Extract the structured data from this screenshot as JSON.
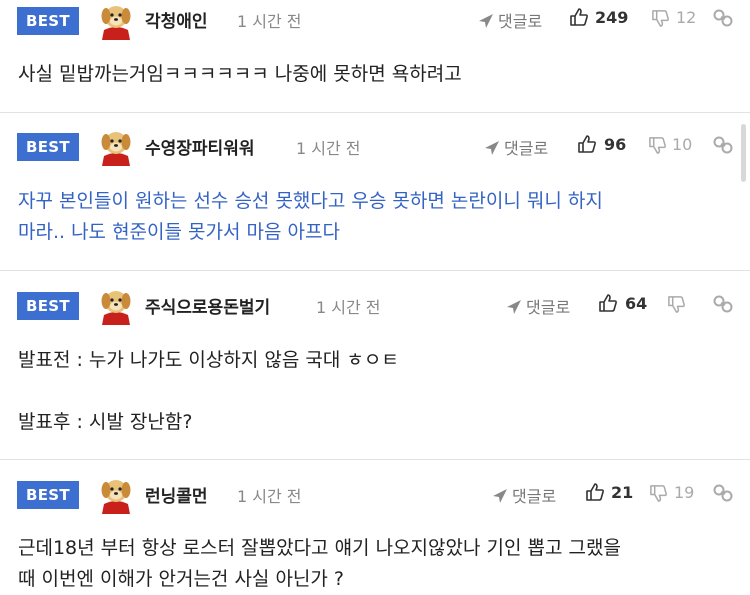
{
  "comments": [
    {
      "badge": "BEST",
      "author": "각청애인",
      "time": "1 시간 전",
      "reply_label": "댓글로",
      "likes": "249",
      "dislikes": "12",
      "lines": [
        "사실 밑밥까는거임ㅋㅋㅋㅋㅋㅋ 나중에 못하면 욕하려고"
      ]
    },
    {
      "badge": "BEST",
      "author": "수영장파티워워",
      "time": "1 시간 전",
      "reply_label": "댓글로",
      "likes": "96",
      "dislikes": "10",
      "lines": [
        "자꾸 본인들이 원하는 선수 승선 못했다고 우승 못하면 논란이니 뭐니 하지",
        "마라.. 나도 현준이들 못가서 마음 아프다"
      ]
    },
    {
      "badge": "BEST",
      "author": "주식으로용돈벌기",
      "time": "1 시간 전",
      "reply_label": "댓글로",
      "likes": "64",
      "dislikes": "",
      "lines": [
        "발표전 : 누가 나가도 이상하지 않음 국대 ㅎㅇㅌ",
        "",
        "발표후 : 시발 장난함?"
      ]
    },
    {
      "badge": "BEST",
      "author": "런닝콜먼",
      "time": "1 시간 전",
      "reply_label": "댓글로",
      "likes": "21",
      "dislikes": "19",
      "lines": [
        "근데18년 부터 항상 로스터 잘뽑았다고 얘기 나오지않았나 기인 뽑고 그랬을",
        "때 이번엔 이해가 안거는건 사실 아닌가 ?"
      ]
    }
  ],
  "colors": {
    "badge_bg": "#3d6fd1",
    "blue_text": "#3563c4",
    "separator": "#e2e2e2"
  },
  "icons": {
    "reply": "paper-plane-icon",
    "like": "thumbs-up-icon",
    "dislike": "thumbs-down-icon",
    "share": "link-icon",
    "avatar": "puppy-avatar-icon"
  }
}
